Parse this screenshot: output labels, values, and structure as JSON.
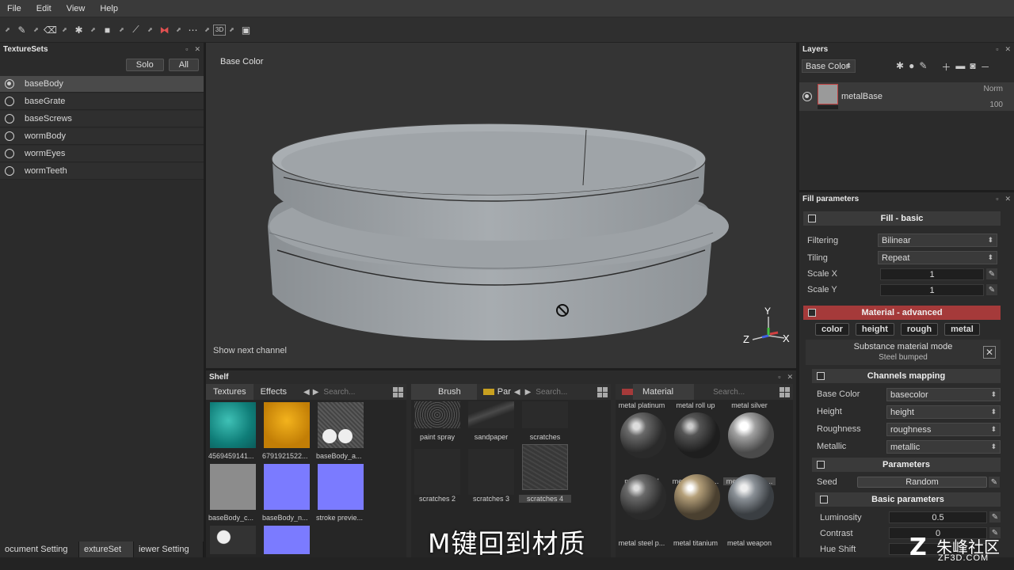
{
  "menu": [
    "File",
    "Edit",
    "View",
    "Help"
  ],
  "texturesets": {
    "title": "TextureSets",
    "solo_label": "Solo",
    "all_label": "All",
    "items": [
      {
        "label": "baseBody",
        "active": true
      },
      {
        "label": "baseGrate"
      },
      {
        "label": "baseScrews"
      },
      {
        "label": "wormBody"
      },
      {
        "label": "wormEyes"
      },
      {
        "label": "wormTeeth"
      }
    ]
  },
  "bottom_tabs": [
    "ocument Setting",
    "extureSet",
    "iewer Setting"
  ],
  "viewport": {
    "channel": "Base Color",
    "hint": "Show next channel",
    "gizmo": {
      "y": "Y",
      "z": "Z",
      "x": "X"
    }
  },
  "shelf": {
    "title": "Shelf",
    "pane1": {
      "tabs": [
        "Textures",
        "Effects"
      ],
      "search": "Search...",
      "items": [
        "4569459141...",
        "6791921522...",
        "baseBody_a...",
        "baseBody_c...",
        "baseBody_n...",
        "stroke previe..."
      ]
    },
    "pane2": {
      "tabs": [
        "Brush",
        "Par"
      ],
      "search": "Search...",
      "items": [
        "paint spray",
        "sandpaper",
        "scratches",
        "scratches 2",
        "scratches 3",
        "scratches 4"
      ]
    },
    "pane3": {
      "tabs": [
        "Material"
      ],
      "search": "Search...",
      "items": [
        "metal platinum",
        "metal roll up",
        "metal silver",
        "metal steel",
        "metal steel b...",
        "metal steel b...",
        "metal steel p...",
        "metal titanium",
        "metal weapon"
      ]
    }
  },
  "layers": {
    "title": "Layers",
    "channel_select": "Base Color",
    "layer": {
      "name": "metalBase",
      "blend": "Norm",
      "opacity": "100"
    }
  },
  "fill": {
    "title": "Fill parameters",
    "fill_basic": "Fill - basic",
    "filtering_label": "Filtering",
    "filtering_value": "Bilinear",
    "tiling_label": "Tiling",
    "tiling_value": "Repeat",
    "scalex_label": "Scale X",
    "scalex_value": "1",
    "scaley_label": "Scale Y",
    "scaley_value": "1",
    "material_advanced": "Material - advanced",
    "channel_buttons": [
      "color",
      "height",
      "rough",
      "metal"
    ],
    "substance_mode_title": "Substance material mode",
    "substance_mode_value": "Steel bumped",
    "channels_mapping": "Channels mapping",
    "mapping": [
      {
        "label": "Base Color",
        "value": "basecolor"
      },
      {
        "label": "Height",
        "value": "height"
      },
      {
        "label": "Roughness",
        "value": "roughness"
      },
      {
        "label": "Metallic",
        "value": "metallic"
      }
    ],
    "parameters": "Parameters",
    "seed_label": "Seed",
    "seed_value": "Random",
    "basic_parameters": "Basic parameters",
    "luminosity_label": "Luminosity",
    "luminosity_value": "0.5",
    "contrast_label": "Contrast",
    "contrast_value": "0",
    "hueshift_label": "Hue Shift"
  },
  "subtitle": "M键回到材质",
  "watermark": {
    "brand": "朱峰社区",
    "url": "ZF3D.COM"
  },
  "colors": {
    "accent_red": "#a53a3a",
    "panel": "#2b2b2b",
    "viewport": "#343434"
  }
}
